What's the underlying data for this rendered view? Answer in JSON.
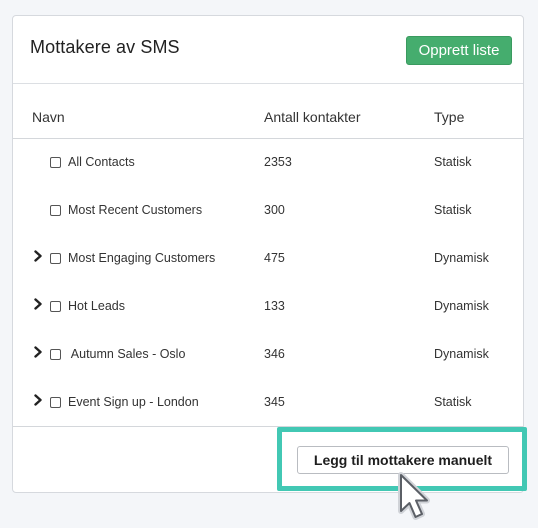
{
  "card": {
    "title": "Mottakere av SMS",
    "create_button": "Opprett liste"
  },
  "table": {
    "headers": {
      "name": "Navn",
      "count": "Antall kontakter",
      "type": "Type"
    },
    "rows": [
      {
        "name": "All Contacts",
        "count": "2353",
        "type": "Statisk",
        "expandable": false
      },
      {
        "name": "Most Recent Customers",
        "count": "300",
        "type": "Statisk",
        "expandable": false
      },
      {
        "name": "Most Engaging Customers",
        "count": "475",
        "type": "Dynamisk",
        "expandable": true
      },
      {
        "name": "Hot Leads",
        "count": "133",
        "type": "Dynamisk",
        "expandable": true
      },
      {
        "name": " Autumn Sales - Oslo",
        "count": "346",
        "type": "Dynamisk",
        "expandable": true
      },
      {
        "name": "Event Sign up - London",
        "count": "345",
        "type": "Statisk",
        "expandable": true
      }
    ]
  },
  "footer": {
    "manual_button": "Legg til mottakere manuelt"
  },
  "colors": {
    "primary_green": "#45ad6e",
    "highlight_teal": "#42c8b4"
  },
  "icons": {
    "expand": "chevron-right-icon",
    "pointer": "mouse-pointer-icon"
  }
}
